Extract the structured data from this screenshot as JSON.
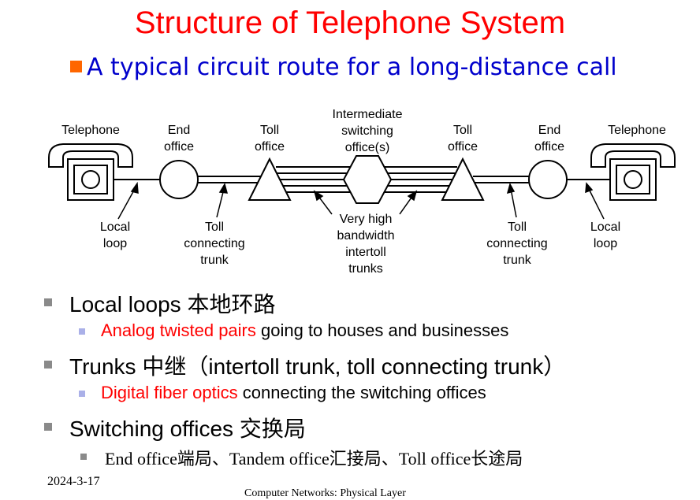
{
  "title": "Structure of Telephone System",
  "subtitle": "A typical circuit route for a long-distance call",
  "diagram": {
    "labels": {
      "telephone_left": "Telephone",
      "end_office_left_1": "End",
      "end_office_left_2": "office",
      "toll_office_left_1": "Toll",
      "toll_office_left_2": "office",
      "intermediate_1": "Intermediate",
      "intermediate_2": "switching",
      "intermediate_3": "office(s)",
      "toll_office_right_1": "Toll",
      "toll_office_right_2": "office",
      "end_office_right_1": "End",
      "end_office_right_2": "office",
      "telephone_right": "Telephone",
      "local_loop_left_1": "Local",
      "local_loop_left_2": "loop",
      "toll_trunk_left_1": "Toll",
      "toll_trunk_left_2": "connecting",
      "toll_trunk_left_3": "trunk",
      "intertoll_1": "Very high",
      "intertoll_2": "bandwidth",
      "intertoll_3": "intertoll",
      "intertoll_4": "trunks",
      "toll_trunk_right_1": "Toll",
      "toll_trunk_right_2": "connecting",
      "toll_trunk_right_3": "trunk",
      "local_loop_right_1": "Local",
      "local_loop_right_2": "loop"
    }
  },
  "bullets": {
    "b1": {
      "en": "Local loops",
      "zh": "本地环路"
    },
    "b1_sub": {
      "red": "Analog twisted pairs",
      "rest": " going to houses and businesses"
    },
    "b2": {
      "en": "Trunks",
      "zh": "中继（",
      "paren": "intertoll trunk, toll connecting trunk",
      "close": "）"
    },
    "b2_sub": {
      "red": "Digital fiber optics",
      "rest": " connecting the switching offices"
    },
    "b3": {
      "en": "Switching offices",
      "zh": "交换局"
    },
    "b3_sub": {
      "text": "End office端局、Tandem office汇接局、Toll office长途局"
    }
  },
  "footer": {
    "date": "2024-3-17",
    "caption": "Computer Networks: Physical Layer"
  }
}
